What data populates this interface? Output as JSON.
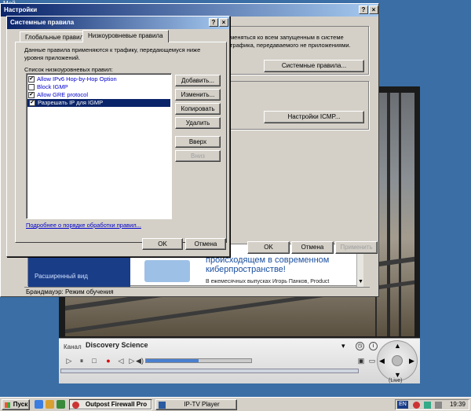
{
  "desktop": {
    "icon_label": "Мой"
  },
  "tv_player": {
    "channel_label": "Канал",
    "channel_value": "Discovery Science",
    "volume_level": 0.5,
    "dpad_label": "(Live)",
    "controls": [
      "play",
      "pause",
      "stop",
      "record",
      "rewind",
      "forward",
      "mute"
    ]
  },
  "settings_window": {
    "title": "Настройки",
    "help_btn": "?",
    "close_btn": "×",
    "desc_line1": "меняться ко всем запущенным в системе",
    "desc_line2": "трафика, передаваемого не приложениями.",
    "system_rules_btn": "Системные правила...",
    "icmp_btn": "Настройки ICMP...",
    "ok": "OK",
    "cancel": "Отмена",
    "apply": "Применить",
    "status": "Брандмауэр: Режим обучения",
    "ad": {
      "side_text": "Расширенный вид",
      "headline": "происходящем в современном киберпространстве!",
      "subtext": "В ежемесячных выпусках Игорь Панков, Product"
    }
  },
  "sys_dialog": {
    "title": "Системные правила",
    "help_btn": "?",
    "close_btn": "×",
    "tabs": [
      "Глобальные правила",
      "Низкоуровневые правила"
    ],
    "description": "Данные правила применяются к трафику, передающемуся ниже уровня приложений.",
    "list_label": "Список низкоуровневых правил:",
    "rules": [
      {
        "label": "Allow IPv6 Hop-by-Hop Option",
        "checked": true
      },
      {
        "label": "Block IGMP",
        "checked": false
      },
      {
        "label": "Allow GRE protocol",
        "checked": true
      },
      {
        "label": "Разрешать IP для IGMP",
        "checked": true
      }
    ],
    "buttons": {
      "add": "Добавить...",
      "edit": "Изменить...",
      "copy": "Копировать",
      "delete": "Удалить",
      "up": "Вверх",
      "down": "Вниз"
    },
    "more_link": "Подробнее о порядке обработки правил...",
    "ok": "OK",
    "cancel": "Отмена"
  },
  "taskbar": {
    "start": "Пуск",
    "tasks": [
      "Outpost Firewall Pro",
      "IP-TV Player"
    ],
    "lang": "EN",
    "clock": "19:39"
  }
}
